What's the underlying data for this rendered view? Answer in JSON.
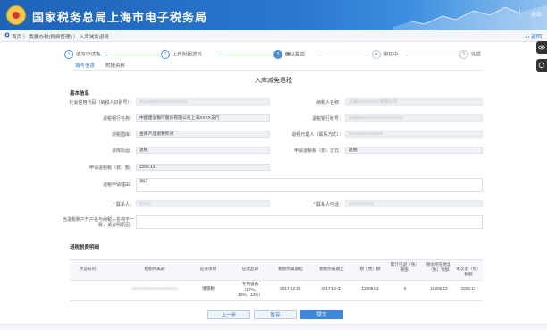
{
  "header": {
    "site_title": "国家税务总局上海市电子税务局",
    "logout_label": "退出",
    "user_label": "|"
  },
  "breadcrumb": {
    "text": "首页 〉 我要办税(税费管理) 〉 入库减免退税",
    "back_label": "返回"
  },
  "steps": [
    {
      "num": "1",
      "label": "填写申请表",
      "state": "done"
    },
    {
      "num": "2",
      "label": "上传附报资料",
      "state": "done"
    },
    {
      "num": "3",
      "label": "确认提交",
      "state": "active"
    },
    {
      "num": "4",
      "label": "审核中",
      "state": "todo"
    },
    {
      "num": "5",
      "label": "完成",
      "state": "todo"
    }
  ],
  "tabs": [
    {
      "label": "填写信息",
      "active": true
    },
    {
      "label": "附报资料",
      "active": false
    }
  ],
  "form": {
    "title": "入库减免退税",
    "basic_section": "基本信息",
    "fields": {
      "credit_code_label": "社会信用代码（纳税人识别号）：",
      "credit_code_value": "91310000XXXXXXXXXX",
      "taxpayer_name_label": "纳税人名称：",
      "taxpayer_name_value": "上海XXXXXXXX有限公司",
      "refund_bank_label": "退税银行名称：",
      "refund_bank_value": "中国建设银行股份有限公司上海XXXX支行",
      "refund_account_label": "退税银行账号：",
      "refund_account_value": "31050XXXXXXXXXXXXXXX",
      "treasury_label": "退税国库：",
      "treasury_value": "金库产品退税积点",
      "agent_label": "退税代理人（联系方式）：",
      "agent_value": "XXXXXXXXXXXX",
      "method_label": "退库原因：",
      "method_value": "退税",
      "refund_type_label": "申请退税税（费）方式：",
      "refund_type_value": "退税",
      "amount_label": "申请退税税（费）额：",
      "amount_value": "2205.13",
      "reason_label": "退税申请理由：",
      "reason_value": "测试",
      "contact_label": "联系人：",
      "contact_value": "XXXX",
      "contact_phone_label": "联系人电话：",
      "contact_phone_value": "1XXXXXXXX",
      "account_mismatch_label": "当退税账户开户名与纳税人名称不一致，请说明原因：",
      "account_mismatch_value": ""
    }
  },
  "refund_table": {
    "section": "退税税费明细",
    "headers": [
      "凭证号码",
      "税额所属期",
      "征收项目",
      "征收品目",
      "税款所属期起",
      "税款所属期止",
      "税（费）额",
      "累计已退（免）税额",
      "税收所在地退（免）税额",
      "本次退（免）税额"
    ],
    "rows": [
      [
        "XXXXXXXXXXXXXXXXX",
        "",
        "增值税",
        "专用设备（17%、13%、13%）",
        "2017-12-01",
        "2017-12-31",
        "12205.13",
        "0",
        "12205.13",
        "2205.13"
      ]
    ]
  },
  "buttons": {
    "prev_label": "上一步",
    "save_label": "暂存",
    "submit_label": "提交"
  },
  "colors": {
    "header_blue": "#1e63b8",
    "accent": "#3d86dd"
  }
}
